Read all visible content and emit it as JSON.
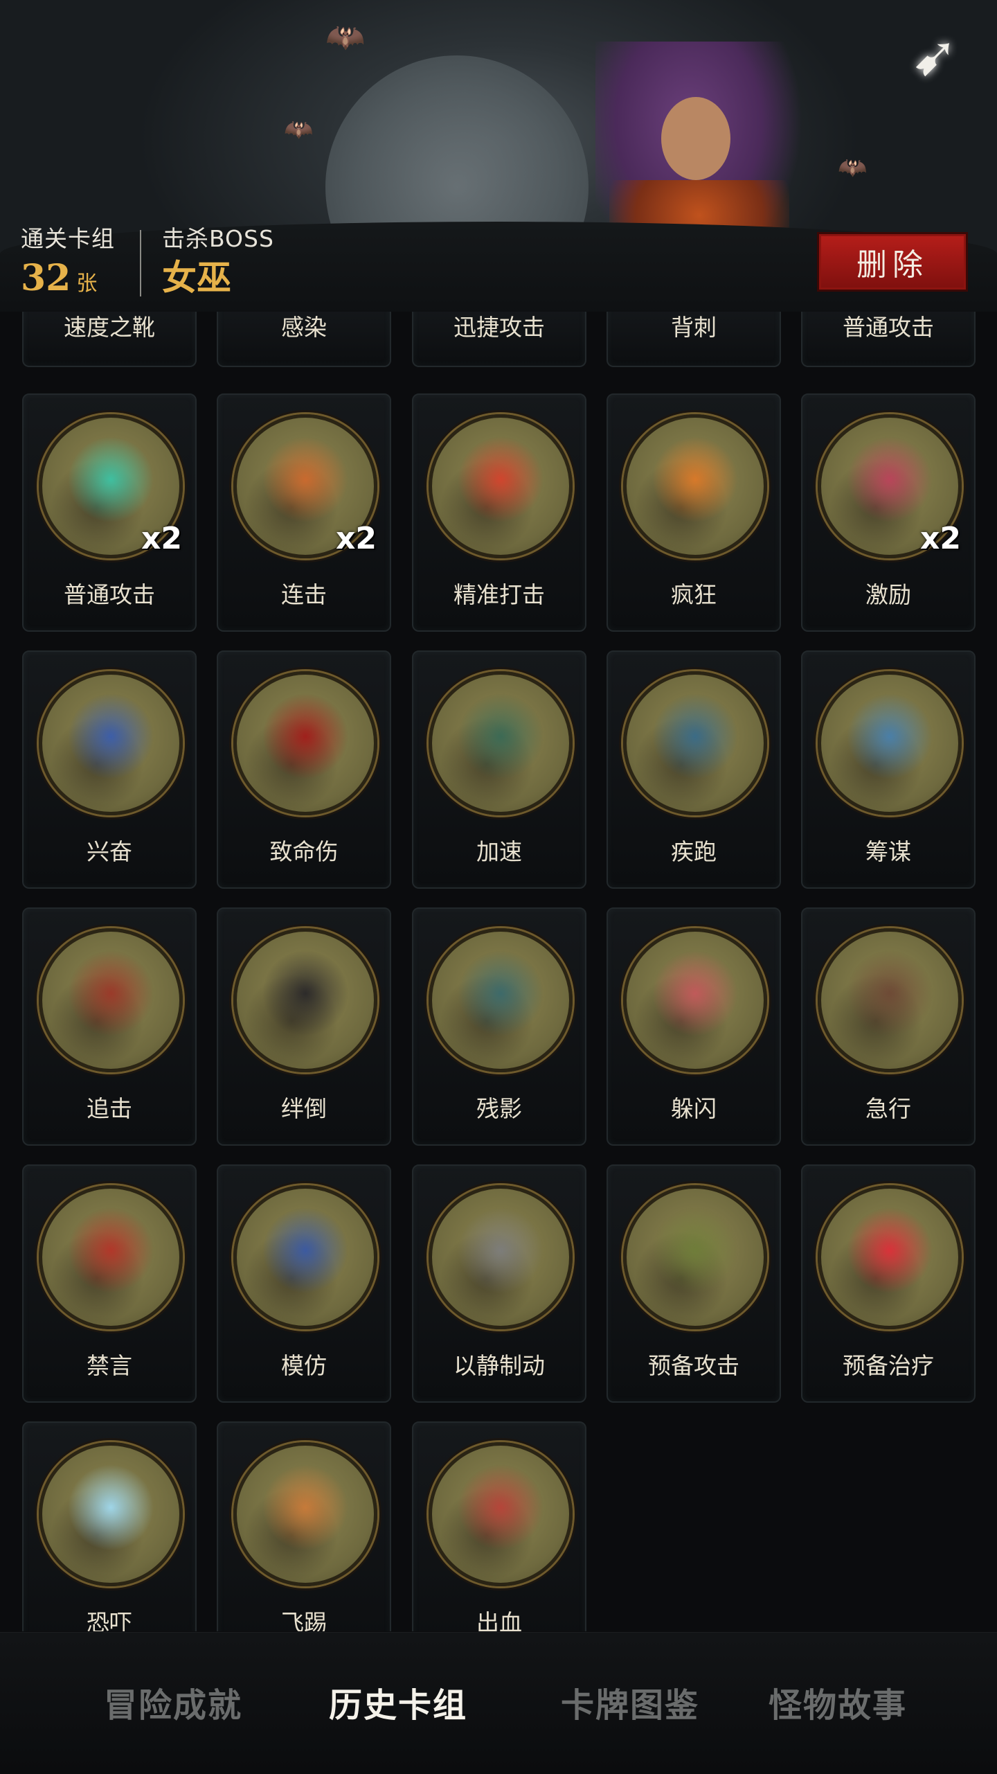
{
  "header": {
    "cleared_deck_label": "通关卡组",
    "cleared_deck_value": "32",
    "cleared_deck_unit": "张",
    "boss_label": "击杀BOSS",
    "boss_value": "女巫",
    "delete_label": "删除",
    "back_icon": "back-arrow-icon"
  },
  "partial_cards": [
    {
      "name": "速度之靴"
    },
    {
      "name": "感染"
    },
    {
      "name": "迅捷攻击"
    },
    {
      "name": "背刺"
    },
    {
      "name": "普通攻击"
    }
  ],
  "cards": [
    {
      "name": "普通攻击",
      "multiplier": "x2",
      "accent": "#3fbfa0"
    },
    {
      "name": "连击",
      "multiplier": "x2",
      "accent": "#c96a2f"
    },
    {
      "name": "精准打击",
      "multiplier": "",
      "accent": "#d0452e"
    },
    {
      "name": "疯狂",
      "multiplier": "",
      "accent": "#d7792a"
    },
    {
      "name": "激励",
      "multiplier": "x2",
      "accent": "#b8455a"
    },
    {
      "name": "兴奋",
      "multiplier": "",
      "accent": "#3d5ea8"
    },
    {
      "name": "致命伤",
      "multiplier": "",
      "accent": "#a0201c"
    },
    {
      "name": "加速",
      "multiplier": "",
      "accent": "#3c6a55"
    },
    {
      "name": "疾跑",
      "multiplier": "",
      "accent": "#3b6b86"
    },
    {
      "name": "筹谋",
      "multiplier": "",
      "accent": "#4a7fa8"
    },
    {
      "name": "追击",
      "multiplier": "",
      "accent": "#9a3a2a"
    },
    {
      "name": "绊倒",
      "multiplier": "",
      "accent": "#2c2a2a"
    },
    {
      "name": "残影",
      "multiplier": "",
      "accent": "#3d6a6a"
    },
    {
      "name": "躲闪",
      "multiplier": "",
      "accent": "#c05a5a"
    },
    {
      "name": "急行",
      "multiplier": "",
      "accent": "#6e4a36"
    },
    {
      "name": "禁言",
      "multiplier": "",
      "accent": "#b1372a"
    },
    {
      "name": "模仿",
      "multiplier": "",
      "accent": "#3c5aa0"
    },
    {
      "name": "以静制动",
      "multiplier": "",
      "accent": "#7d7d7a"
    },
    {
      "name": "预备攻击",
      "multiplier": "",
      "accent": "#6f7d3a"
    },
    {
      "name": "预备治疗",
      "multiplier": "",
      "accent": "#d8323a"
    },
    {
      "name": "恐吓",
      "multiplier": "",
      "accent": "#9fd5e8"
    },
    {
      "name": "飞踢",
      "multiplier": "",
      "accent": "#c67a3a"
    },
    {
      "name": "出血",
      "multiplier": "",
      "accent": "#b5453a"
    }
  ],
  "tabs": [
    {
      "label": "冒险成就",
      "active": false
    },
    {
      "label": "历史卡组",
      "active": true
    },
    {
      "label": "卡牌图鉴",
      "active": false
    },
    {
      "label": "怪物故事",
      "active": false
    }
  ]
}
